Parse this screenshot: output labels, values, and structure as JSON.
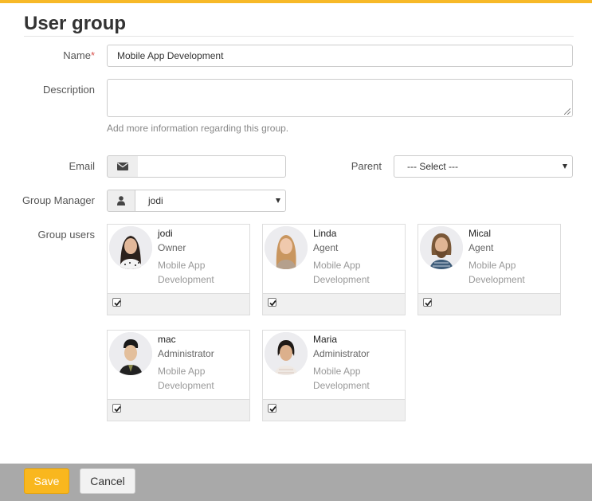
{
  "colors": {
    "accent": "#f7b928",
    "save_button": "#f9b71e",
    "footer": "#a9a9a9"
  },
  "page": {
    "title": "User group"
  },
  "form": {
    "name": {
      "label": "Name",
      "required_mark": "*",
      "value": "Mobile App Development"
    },
    "description": {
      "label": "Description",
      "value": "",
      "help": "Add more information regarding this group."
    },
    "email": {
      "label": "Email",
      "value": "",
      "icon": "envelope-icon"
    },
    "parent": {
      "label": "Parent",
      "selected": "--- Select ---"
    },
    "group_manager": {
      "label": "Group Manager",
      "selected": "jodi",
      "icon": "user-icon"
    },
    "group_users": {
      "label": "Group users"
    }
  },
  "users": [
    {
      "name": "jodi",
      "role": "Owner",
      "group_line1": "Mobile App",
      "group_line2": "Development",
      "checked": true
    },
    {
      "name": "Linda",
      "role": "Agent",
      "group_line1": "Mobile App",
      "group_line2": "Development",
      "checked": true
    },
    {
      "name": "Mical",
      "role": "Agent",
      "group_line1": "Mobile App",
      "group_line2": "Development",
      "checked": true
    },
    {
      "name": "mac",
      "role": "Administrator",
      "group_line1": "Mobile App",
      "group_line2": "Development",
      "checked": true
    },
    {
      "name": "Maria",
      "role": "Administrator",
      "group_line1": "Mobile App",
      "group_line2": "Development",
      "checked": true
    }
  ],
  "actions": {
    "save": "Save",
    "cancel": "Cancel"
  }
}
